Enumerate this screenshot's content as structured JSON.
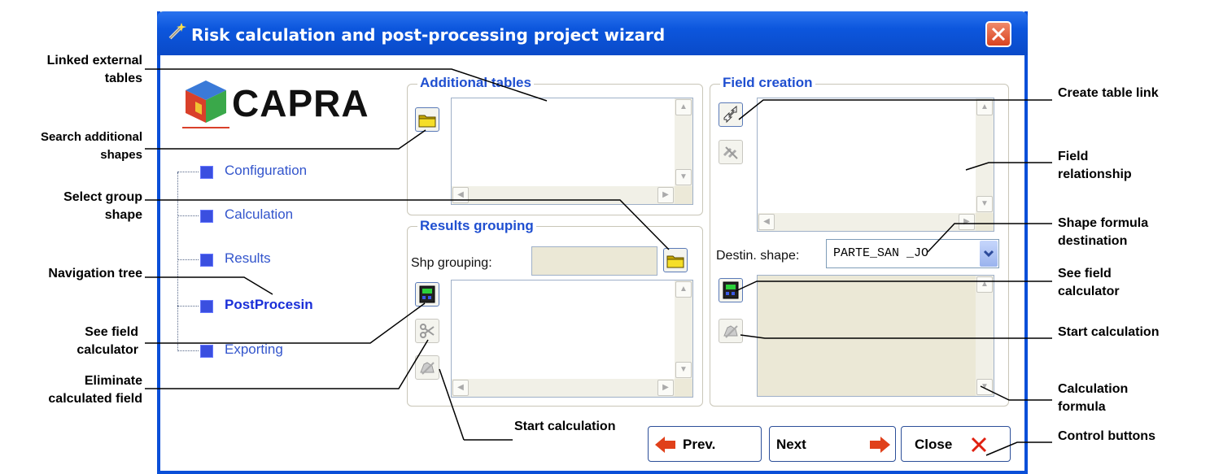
{
  "window": {
    "title": "Risk calculation and post-processing project wizard"
  },
  "logo": {
    "text": "CAPRA"
  },
  "tree": {
    "items": [
      {
        "label": "Configuration",
        "active": false
      },
      {
        "label": "Calculation",
        "active": false
      },
      {
        "label": "Results",
        "active": false
      },
      {
        "label": "PostProcesin",
        "active": true
      },
      {
        "label": "Exporting",
        "active": false
      }
    ]
  },
  "additional_tables": {
    "title": "Additional tables"
  },
  "results_grouping": {
    "title": "Results grouping",
    "shp_label": "Shp grouping:"
  },
  "field_creation": {
    "title": "Field creation",
    "destin_label": "Destin. shape:",
    "destin_value": "PARTE_SAN _JO"
  },
  "buttons": {
    "prev": "Prev.",
    "next": "Next",
    "close": "Close"
  },
  "annotations": {
    "linked_tables_1": "Linked external",
    "linked_tables_2": "tables",
    "search_shapes_1": "Search additional",
    "search_shapes_2": "shapes",
    "select_group_1": "Select group",
    "select_group_2": "shape",
    "nav_tree": "Navigation tree",
    "see_calc_left_1": "See field",
    "see_calc_left_2": "calculator",
    "elim_1": "Eliminate",
    "elim_2": "calculated field",
    "start_calc_bottom": "Start calculation",
    "create_link": "Create table link",
    "field_rel_1": "Field",
    "field_rel_2": "relationship",
    "shape_formula_1": "Shape formula",
    "shape_formula_2": "destination",
    "see_calc_right_1": "See field",
    "see_calc_right_2": "calculator",
    "start_calc_right": "Start calculation",
    "calc_formula_1": "Calculation",
    "calc_formula_2": "formula",
    "control_buttons": "Control buttons"
  },
  "colors": {
    "titlebar": "#0c56dd",
    "group_title": "#1f4fd0",
    "tree_link": "#3355cc",
    "close_red": "#d9421f"
  }
}
